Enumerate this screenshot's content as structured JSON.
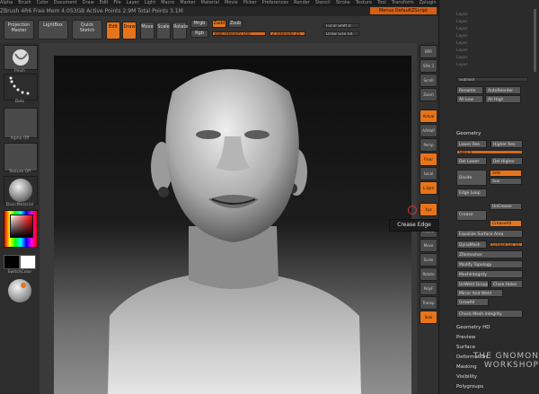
{
  "menubar": [
    "Alpha",
    "Brush",
    "Color",
    "Document",
    "Draw",
    "Edit",
    "File",
    "Layer",
    "Light",
    "Macro",
    "Marker",
    "Material",
    "Movie",
    "Picker",
    "Preferences",
    "Render",
    "Stencil",
    "Stroke",
    "Texture",
    "Tool",
    "Transform",
    "Zplugin",
    "Zscript"
  ],
  "titlebar": "ZBrush 4R6   Free Mem 4.053GB   Active Points 2.9M   Total Points 3.1M",
  "top_right_label": "Menus  DefaultZScript",
  "shelf": {
    "projection_master": "Projection Master",
    "lightbox": "LightBox",
    "quick_sketch": "Quick Sketch",
    "edit": "Edit",
    "draw": "Draw",
    "move": "Move",
    "scale": "Scale",
    "rotate": "Rotate",
    "mrgb": "Mrgb",
    "rgb": "Rgb",
    "m": "M",
    "zadd": "Zadd",
    "zsub": "Zsub",
    "focal_shift": "Focal Shift 0",
    "draw_size": "Draw Size 64",
    "z_intensity": "Z Intensity 25",
    "rgb_intensity": "Rgb Intensity 100"
  },
  "left_tray": {
    "brush_label": "Pinch",
    "stroke_label": "Dots",
    "alpha_label": "Alpha Off",
    "texture_label": "Texture Off",
    "material_label": "BasicMaterial",
    "switch_label": "SwitchColor"
  },
  "toolcol": [
    "BPR",
    "SPix 3",
    "Scroll",
    "Zoom",
    "Actual",
    "AAHalf",
    "Persp",
    "Floor",
    "Local",
    "L.Sym",
    "Xyz",
    "Frame",
    "Move",
    "Scale",
    "Rotate",
    "PolyF",
    "Transp",
    "Solo"
  ],
  "tooltip": "Crease Edge",
  "palette": {
    "layers": [
      "Layer",
      "Layer",
      "Layer",
      "Layer",
      "Layer",
      "Layer",
      "Layer",
      "Layer"
    ],
    "subtool_label": "SubTool",
    "rename": "Rename",
    "auto_reorder": "AutoReorder",
    "all_low": "All Low",
    "all_high": "All High",
    "geometry_header": "Geometry",
    "lower_res": "Lower Res",
    "higher_res": "Higher Res",
    "sdiv": "SDiv 5",
    "del_lower": "Del Lower",
    "del_higher": "Del Higher",
    "divide": "Divide",
    "smt": "Smt",
    "suv": "Suv",
    "edge_loop": "Edge Loop",
    "crease": "Crease",
    "uncrease": "UnCrease",
    "crease_all": "CreaseAll",
    "crease_lvl": "Crease Lvl 15",
    "equalize": "Equalize Surface Area",
    "dynamesh": "DynaMesh",
    "zremesher": "ZRemesher",
    "modify_topology": "Modify Topology",
    "position": "Position",
    "size": "Size",
    "mesh_integrity": "MeshIntegrity",
    "unweld_groups": "UnWeld Groups",
    "close_holes": "Close Holes",
    "mirror_weld": "Mirror And Weld",
    "grow_all": "GrowAll",
    "check_mesh": "Check Mesh Integrity",
    "sections": [
      "Geometry HD",
      "Preview",
      "Surface",
      "Deformation",
      "Masking",
      "Visibility",
      "Polygroups"
    ]
  },
  "watermark": "THE GNOMON WORKSHOP"
}
